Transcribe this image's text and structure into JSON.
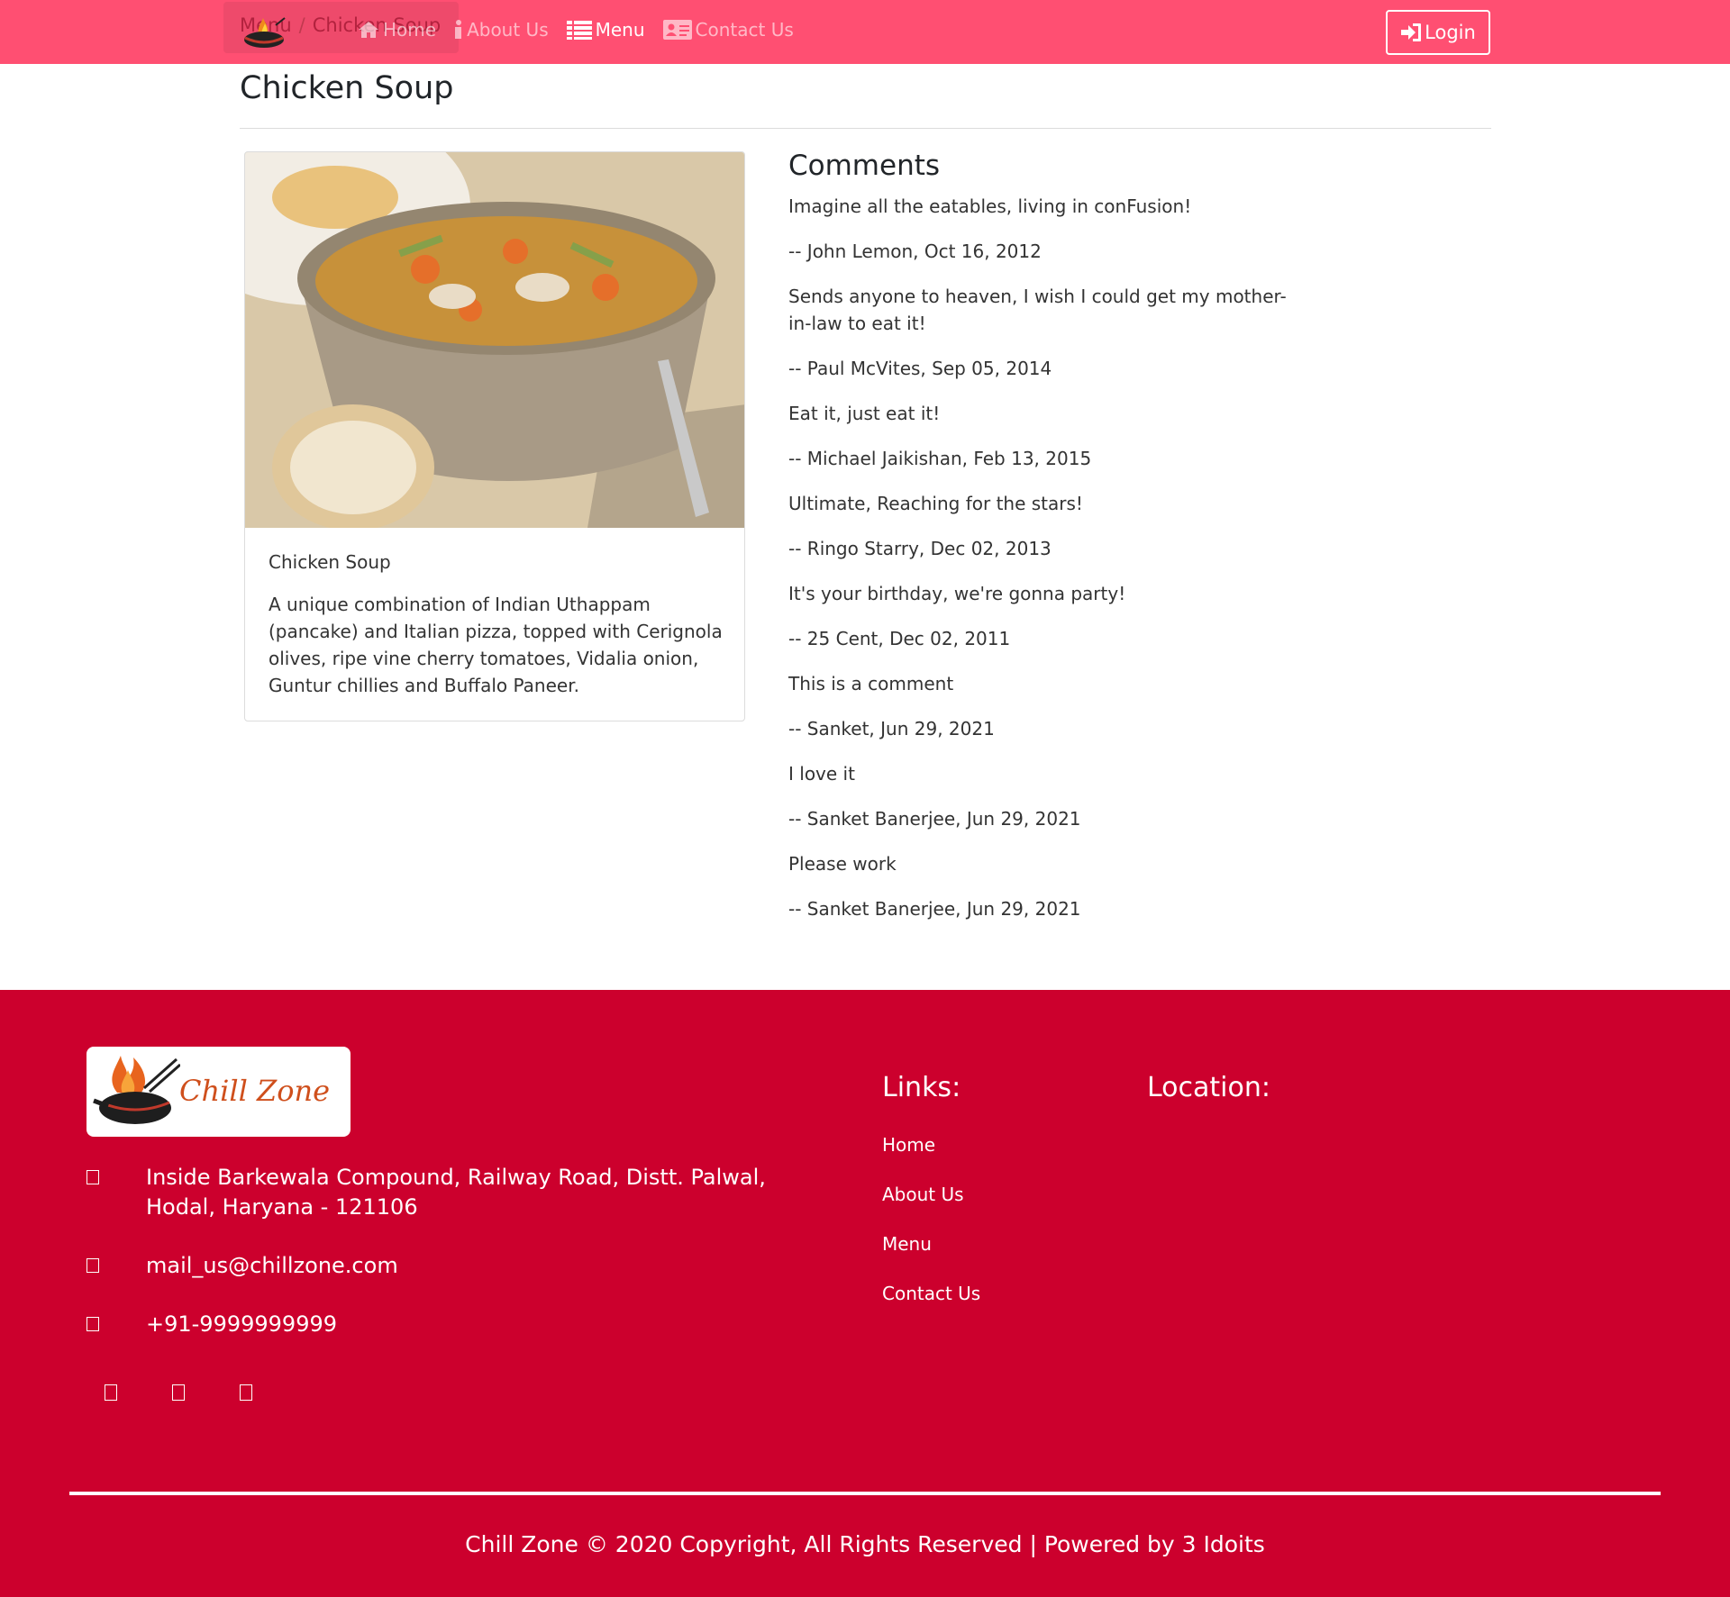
{
  "colors": {
    "navbar": "#ff4f72",
    "footer": "#cc002d",
    "white": "#ffffff"
  },
  "breadcrumb": {
    "items": [
      "Menu",
      "Chicken Soup"
    ]
  },
  "nav": {
    "items": [
      {
        "label": "Home",
        "icon": "home-icon",
        "active": false
      },
      {
        "label": "About Us",
        "icon": "info-icon",
        "active": false
      },
      {
        "label": "Menu",
        "icon": "list-icon",
        "active": true
      },
      {
        "label": "Contact Us",
        "icon": "address-card-icon",
        "active": false
      }
    ],
    "login_label": "Login"
  },
  "dish": {
    "title": "Chicken Soup",
    "card_title": "Chicken Soup",
    "description": "A unique combination of Indian Uthappam (pancake) and Italian pizza, topped with Cerignola olives, ripe vine cherry tomatoes, Vidalia onion, Guntur chillies and Buffalo Paneer."
  },
  "comments": {
    "heading": "Comments",
    "items": [
      {
        "text": "Imagine all the eatables, living in conFusion!",
        "author": "-- John Lemon,  Oct 16, 2012"
      },
      {
        "text": "Sends anyone to heaven, I wish I could get my mother-in-law to eat it!",
        "author": "-- Paul McVites,  Sep 05, 2014"
      },
      {
        "text": "Eat it, just eat it!",
        "author": "-- Michael Jaikishan,  Feb 13, 2015"
      },
      {
        "text": "Ultimate, Reaching for the stars!",
        "author": "-- Ringo Starry,  Dec 02, 2013"
      },
      {
        "text": "It's your birthday, we're gonna party!",
        "author": "-- 25 Cent,  Dec 02, 2011"
      },
      {
        "text": "This is a comment",
        "author": "-- Sanket,  Jun 29, 2021"
      },
      {
        "text": "I love it",
        "author": "-- Sanket Banerjee,  Jun 29, 2021"
      },
      {
        "text": "Please work",
        "author": "-- Sanket Banerjee,  Jun 29, 2021"
      }
    ]
  },
  "footer": {
    "logo_text": "Chill Zone",
    "address": "Inside Barkewala Compound, Railway Road, Distt. Palwal, Hodal, Haryana - 121106",
    "email": "mail_us@chillzone.com",
    "phone": "+91-9999999999",
    "links_heading": "Links:",
    "links": [
      "Home",
      "About Us",
      "Menu",
      "Contact Us"
    ],
    "location_heading": "Location:",
    "copyright": "Chill Zone © 2020 Copyright, All Rights Reserved | Powered by 3 Idoits"
  }
}
